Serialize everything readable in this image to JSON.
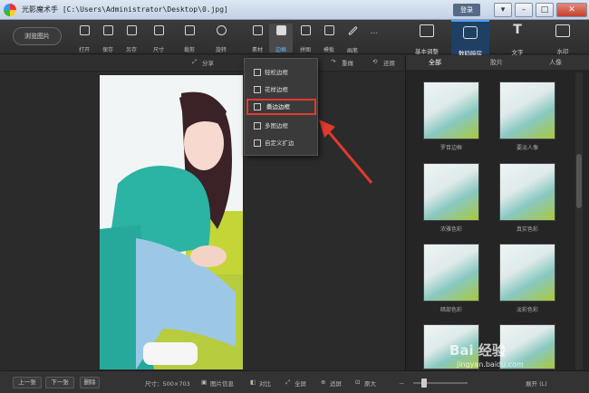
{
  "window": {
    "app_name": "光影魔术手",
    "title": "光影魔术手 [C:\\Users\\Administrator\\Desktop\\0.jpg]",
    "login_label": "登录",
    "buttons": [
      "▾",
      "–",
      "□",
      "✕"
    ]
  },
  "toolbar": {
    "browse_label": "浏览图片",
    "tools": [
      {
        "label": "打开",
        "icon": "open-icon"
      },
      {
        "label": "保存",
        "icon": "save-icon"
      },
      {
        "label": "另存",
        "icon": "save-as-icon"
      },
      {
        "label": "尺寸",
        "icon": "resize-icon"
      },
      {
        "label": "裁剪",
        "icon": "crop-icon"
      },
      {
        "label": "旋转",
        "icon": "rotate-icon"
      },
      {
        "label": "素材",
        "icon": "material-icon"
      },
      {
        "label": "边框",
        "icon": "border-icon",
        "active": true
      },
      {
        "label": "拼图",
        "icon": "collage-icon"
      },
      {
        "label": "模板",
        "icon": "template-icon"
      },
      {
        "label": "画笔",
        "icon": "brush-icon"
      },
      {
        "label": "...",
        "icon": "more-icon"
      }
    ],
    "right_tabs": [
      {
        "label": "基本调整",
        "icon": "adjust-icon"
      },
      {
        "label": "数码暗房",
        "icon": "camera-icon",
        "active": true
      },
      {
        "label": "文字",
        "icon": "text-icon"
      },
      {
        "label": "水印",
        "icon": "watermark-icon"
      }
    ]
  },
  "subbar": {
    "share_label": "分享",
    "redo_label": "重做",
    "restore_label": "还原"
  },
  "border_menu": {
    "items": [
      {
        "label": "轻松边框",
        "highlighted": false
      },
      {
        "label": "花样边框",
        "highlighted": false
      },
      {
        "label": "撕边边框",
        "highlighted": true
      },
      {
        "label": "多图边框",
        "highlighted": false
      },
      {
        "label": "自定义扩边",
        "highlighted": false
      }
    ]
  },
  "effects_panel": {
    "tabs": [
      "全部",
      "胶片",
      "人像"
    ],
    "active_tab": "全部",
    "thumbnails": [
      {
        "label": "罗目边框"
      },
      {
        "label": "要淡人像"
      },
      {
        "label": "浓雅色彩"
      },
      {
        "label": "真实色彩"
      },
      {
        "label": "暗部色彩"
      },
      {
        "label": "淡彩色彩"
      },
      {
        "label": ""
      },
      {
        "label": ""
      }
    ]
  },
  "statusbar": {
    "prev_label": "上一张",
    "next_label": "下一张",
    "delete_label": "删除",
    "size_text": "尺寸：500×703",
    "info_label": "图片信息",
    "compare_label": "对比",
    "fullscreen_label": "全屏",
    "fit_label": "适屏",
    "zoom_label": "原大",
    "expand_label": "展开 (L)",
    "zoom_level": 0.2
  },
  "watermark": {
    "logo": "Bai 经验",
    "url": "jingyan.baidu.com"
  },
  "colors": {
    "highlight_box": "#e03a2e",
    "accent": "#4fa0ff",
    "arrow": "#e03a2e"
  }
}
